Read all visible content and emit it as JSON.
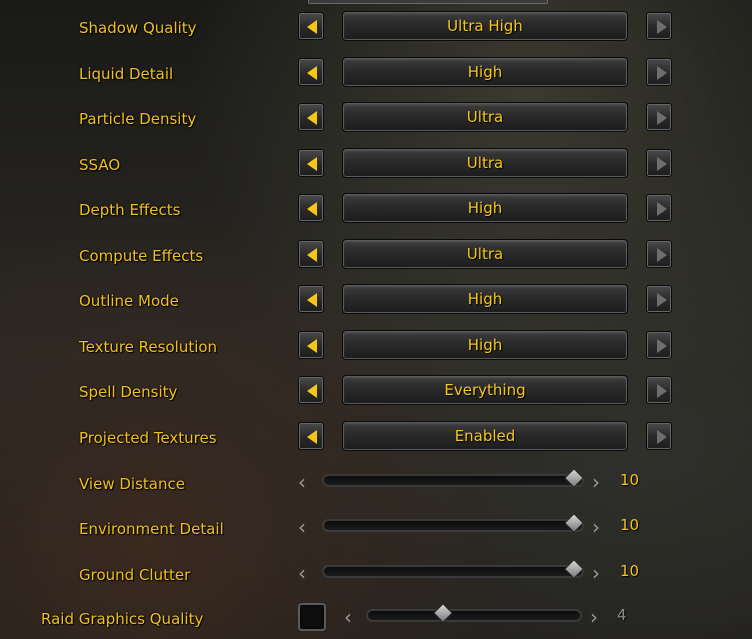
{
  "dropdown_settings": [
    {
      "label": "Shadow Quality",
      "value": "Ultra High"
    },
    {
      "label": "Liquid Detail",
      "value": "High"
    },
    {
      "label": "Particle Density",
      "value": "Ultra"
    },
    {
      "label": "SSAO",
      "value": "Ultra"
    },
    {
      "label": "Depth Effects",
      "value": "High"
    },
    {
      "label": "Compute Effects",
      "value": "Ultra"
    },
    {
      "label": "Outline Mode",
      "value": "High"
    },
    {
      "label": "Texture Resolution",
      "value": "High"
    },
    {
      "label": "Spell Density",
      "value": "Everything"
    },
    {
      "label": "Projected Textures",
      "value": "Enabled"
    }
  ],
  "slider_settings": [
    {
      "label": "View Distance",
      "value": "10",
      "level": 1.0
    },
    {
      "label": "Environment Detail",
      "value": "10",
      "level": 1.0
    },
    {
      "label": "Ground Clutter",
      "value": "10",
      "level": 1.0
    }
  ],
  "raid_graphics": {
    "label": "Raid Graphics Quality",
    "value": "4",
    "level": 0.333,
    "checkbox_checked": false
  },
  "colors": {
    "label_gold": "#f0c020",
    "arrow_gold": "#f6c51a",
    "disabled_gray": "#8b8b8b"
  },
  "icons": {
    "prev": "left-triangle-icon",
    "next": "right-triangle-icon",
    "slider_prev": "chevron-left-icon",
    "slider_next": "chevron-right-icon"
  }
}
